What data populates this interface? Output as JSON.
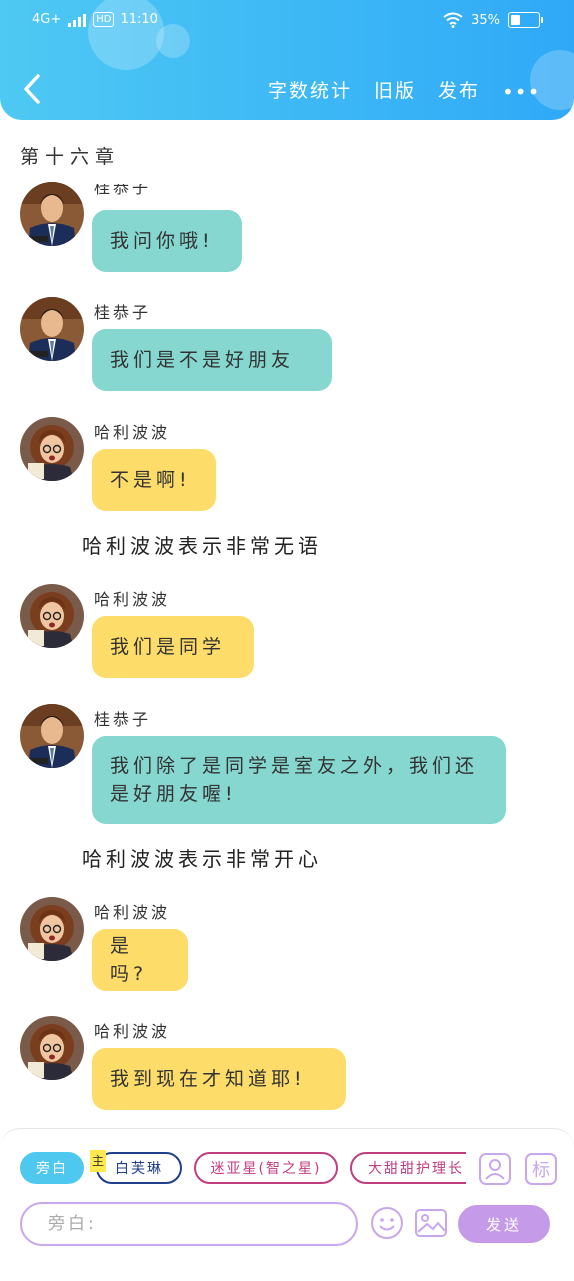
{
  "status_bar": {
    "network": "4G+",
    "hd": "HD",
    "time": "11:10",
    "battery": "35%",
    "battery_level": 0.35
  },
  "nav": {
    "back_icon": "chevron-left-icon",
    "actions": [
      "字数统计",
      "旧版",
      "发布"
    ],
    "more": "•••"
  },
  "chapter_title": "第十六章",
  "messages": [
    {
      "speaker": "桂恭子",
      "text": "我问你哦!",
      "color": "#85d7cf",
      "avatar": "boy-avatar"
    },
    {
      "speaker": "桂恭子",
      "text": "我们是不是好朋友",
      "color": "#85d7cf",
      "avatar": "boy-avatar"
    },
    {
      "speaker": "哈利波波",
      "text": "不是啊!",
      "color": "#fddc6a",
      "avatar": "girl-avatar"
    },
    {
      "narration": "哈利波波表示非常无语"
    },
    {
      "speaker": "哈利波波",
      "text": "我们是同学",
      "color": "#fddc6a",
      "avatar": "girl-avatar"
    },
    {
      "speaker": "桂恭子",
      "text": "我们除了是同学是室友之外，我们还是好朋友喔!",
      "color": "#85d7cf",
      "avatar": "boy-avatar"
    },
    {
      "narration": "哈利波波表示非常开心"
    },
    {
      "speaker": "哈利波波",
      "text": "是吗?",
      "color": "#fddc6a",
      "avatar": "girl-avatar"
    },
    {
      "speaker": "哈利波波",
      "text": "我到现在才知道耶!",
      "color": "#fddc6a",
      "avatar": "girl-avatar"
    }
  ],
  "composer": {
    "roles": [
      "旁白",
      "白芙琳",
      "迷亚星(智之星)",
      "大甜甜护理长"
    ],
    "main_tag": "主",
    "input_placeholder": "旁白:",
    "send_label": "发送",
    "icons": [
      "character-icon",
      "tag-icon",
      "emoji-icon",
      "image-icon"
    ],
    "colors": {
      "narration_chip": "#4fc8ef",
      "role_blue": "#1f3f8a",
      "role_pink": "#c23d7f",
      "accent_purple": "#c49ae9"
    }
  }
}
